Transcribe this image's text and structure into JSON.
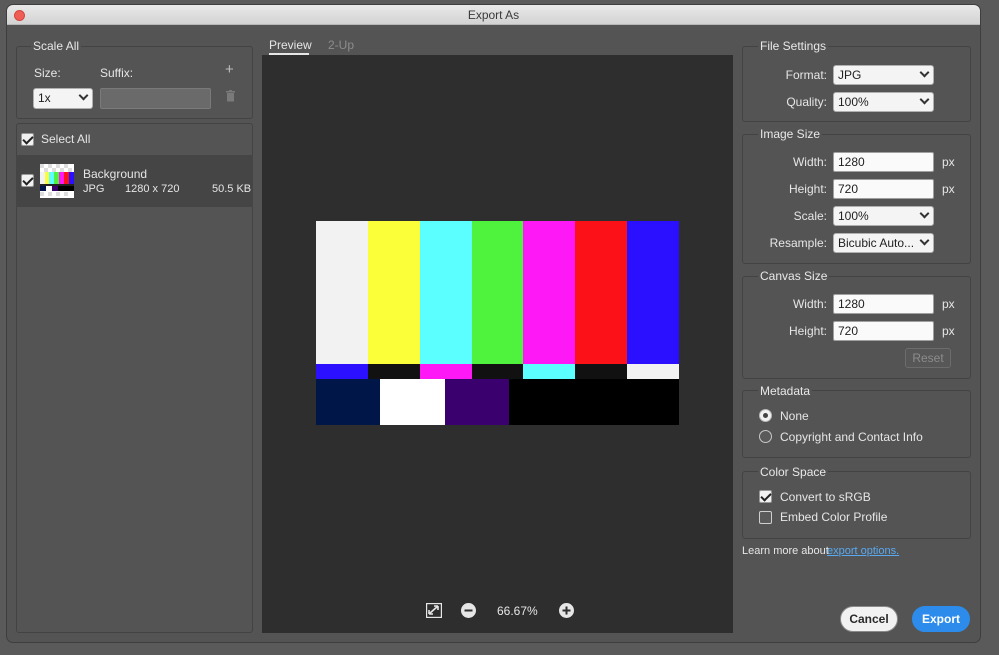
{
  "window": {
    "title": "Export As"
  },
  "scale_all": {
    "title": "Scale All",
    "size_label": "Size:",
    "suffix_label": "Suffix:",
    "size_value": "1x",
    "suffix_value": ""
  },
  "layers": {
    "select_all_label": "Select All",
    "items": [
      {
        "name": "Background",
        "format": "JPG",
        "dimensions": "1280 x 720",
        "file_size": "50.5 KB",
        "checked": true
      }
    ]
  },
  "preview": {
    "tabs": [
      {
        "label": "Preview",
        "active": true
      },
      {
        "label": "2-Up",
        "active": false
      }
    ],
    "zoom": "66.67%",
    "image": {
      "top_bars": [
        "#f2f2f2",
        "#fbff3a",
        "#5cffff",
        "#4ff23c",
        "#ff18f6",
        "#fb1117",
        "#2a10ff"
      ],
      "mid_bars": [
        "#2a10ff",
        "#111111",
        "#ff18f6",
        "#111111",
        "#5cffff",
        "#111111",
        "#f2f2f2"
      ],
      "bottom_bars": [
        "#001548",
        "#ffffff",
        "#3a006e",
        "#000000",
        "#000000"
      ]
    }
  },
  "file_settings": {
    "title": "File Settings",
    "format_label": "Format:",
    "format_value": "JPG",
    "quality_label": "Quality:",
    "quality_value": "100%"
  },
  "image_size": {
    "title": "Image Size",
    "width_label": "Width:",
    "width_value": "1280",
    "height_label": "Height:",
    "height_value": "720",
    "unit": "px",
    "scale_label": "Scale:",
    "scale_value": "100%",
    "resample_label": "Resample:",
    "resample_value": "Bicubic Auto..."
  },
  "canvas_size": {
    "title": "Canvas Size",
    "width_label": "Width:",
    "width_value": "1280",
    "height_label": "Height:",
    "height_value": "720",
    "unit": "px",
    "reset_label": "Reset"
  },
  "metadata": {
    "title": "Metadata",
    "options": [
      {
        "label": "None",
        "selected": true
      },
      {
        "label": "Copyright and Contact Info",
        "selected": false
      }
    ]
  },
  "color_space": {
    "title": "Color Space",
    "convert_label": "Convert to sRGB",
    "convert_checked": true,
    "embed_label": "Embed Color Profile",
    "embed_checked": false
  },
  "footer": {
    "learn_more": "Learn more about",
    "link_text": "export options.",
    "cancel_label": "Cancel",
    "export_label": "Export"
  },
  "colors": {
    "accent": "#2d8ceb",
    "link": "#5aa9f0",
    "close": "#ee5e57"
  }
}
